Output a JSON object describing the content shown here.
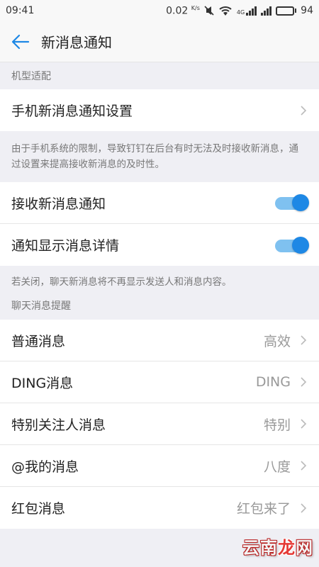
{
  "status_bar": {
    "time": "09:41",
    "speed": "0.02",
    "speed_unit": "K/s",
    "network_type": "4G",
    "battery": "94",
    "icons": [
      "mute-icon",
      "wifi-icon",
      "signal-icon",
      "signal-icon",
      "battery-icon"
    ]
  },
  "header": {
    "back_icon": "arrow-left-icon",
    "title": "新消息通知"
  },
  "sections": {
    "device_label": "机型适配",
    "device_row": {
      "label": "手机新消息通知设置"
    },
    "device_note": "由于手机系统的限制，导致钉钉在后台有时无法及时接收新消息，通过设置来提高接收新消息的及时性。",
    "toggles": [
      {
        "label": "接收新消息通知",
        "on": true
      },
      {
        "label": "通知显示消息详情",
        "on": true
      }
    ],
    "toggle_note": "若关闭，聊天新消息将不再显示发送人和消息内容。",
    "chat_label": "聊天消息提醒",
    "chat_rows": [
      {
        "label": "普通消息",
        "value": "高效"
      },
      {
        "label": "DING消息",
        "value": "DING"
      },
      {
        "label": "特别关注人消息",
        "value": "特别"
      },
      {
        "label": "@我的消息",
        "value": "八度"
      },
      {
        "label": "红包消息",
        "value": "红包来了"
      }
    ]
  },
  "watermark": {
    "text_a": "云南",
    "text_b": "龙",
    "text_c": "网"
  },
  "colors": {
    "accent": "#1e88e5",
    "toggle_track": "#7fc1f0",
    "background": "#efeff4"
  }
}
